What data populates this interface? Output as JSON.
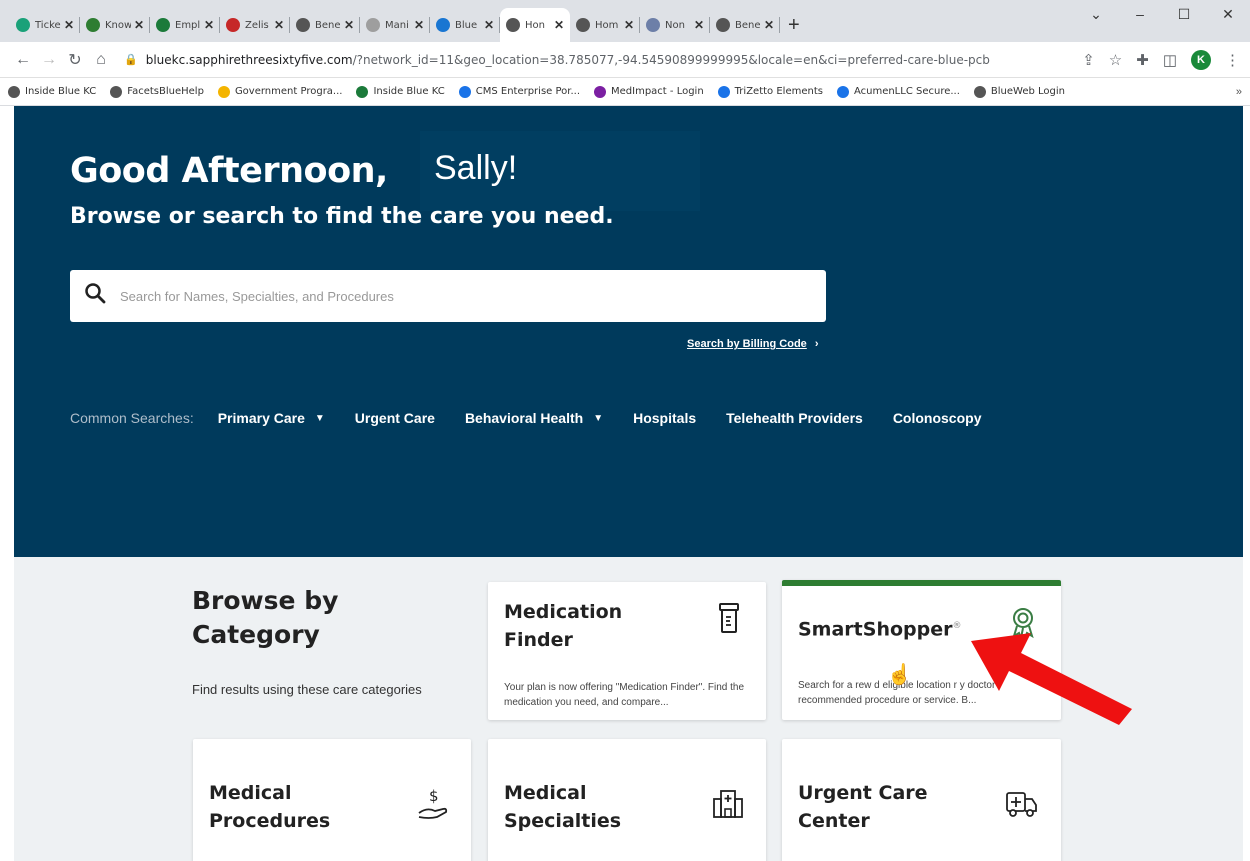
{
  "browser": {
    "tabs": [
      {
        "label": "Ticke",
        "color": "#1aa179"
      },
      {
        "label": "Know",
        "color": "#2e7d32"
      },
      {
        "label": "Empl",
        "color": "#1b7a3a"
      },
      {
        "label": "Zelis",
        "color": "#c62828"
      },
      {
        "label": "Bene",
        "color": "#555555"
      },
      {
        "label": "Mani",
        "color": "#9e9e9e"
      },
      {
        "label": "Blue",
        "color": "#1976d2"
      },
      {
        "label": "Hon",
        "color": "#555555",
        "active": true
      },
      {
        "label": "Hom",
        "color": "#555555"
      },
      {
        "label": "Non",
        "color": "#6d7fa8"
      },
      {
        "label": "Bene",
        "color": "#555555"
      }
    ],
    "url_host": "bluekc.sapphirethreesixtyfive.com",
    "url_path": "/?network_id=11&geo_location=38.785077,-94.54590899999995&locale=en&ci=preferred-care-blue-pcb",
    "profile_initial": "K",
    "bookmarks": [
      {
        "label": "Inside Blue KC",
        "color": "#555555"
      },
      {
        "label": "FacetsBlueHelp",
        "color": "#555555"
      },
      {
        "label": "Government Progra...",
        "color": "#f4b400"
      },
      {
        "label": "Inside Blue KC",
        "color": "#1b7a3a"
      },
      {
        "label": "CMS Enterprise Por...",
        "color": "#1a73e8"
      },
      {
        "label": "MedImpact - Login",
        "color": "#7b1fa2"
      },
      {
        "label": "TriZetto Elements",
        "color": "#1a73e8"
      },
      {
        "label": "AcumenLLC Secure...",
        "color": "#1a73e8"
      },
      {
        "label": "BlueWeb Login",
        "color": "#555555"
      }
    ],
    "bookmarks_more": "»"
  },
  "hero": {
    "greeting": "Good Afternoon,",
    "name": "Sally!",
    "subtitle": "Browse or search to find the care you need.",
    "search_placeholder": "Search for Names, Specialties, and Procedures",
    "billing_link": "Search by Billing Code",
    "common_label": "Common Searches:",
    "common_items": [
      "Primary Care",
      "Urgent Care",
      "Behavioral Health",
      "Hospitals",
      "Telehealth Providers",
      "Colonoscopy"
    ]
  },
  "browse": {
    "title_line1": "Browse by",
    "title_line2": "Category",
    "subtitle": "Find results using these care categories"
  },
  "cards": {
    "medication": {
      "title_line1": "Medication",
      "title_line2": "Finder",
      "desc": "Your plan is now offering \"Medication Finder\". Find the medication you need, and compare..."
    },
    "smartshopper": {
      "title": "SmartShopper",
      "mark": "®",
      "desc": "Search for a rew   d eligible location   r y doctor recommended procedure or service. B..."
    },
    "procedures": {
      "title_line1": "Medical",
      "title_line2": "Procedures"
    },
    "specialties": {
      "title_line1": "Medical",
      "title_line2": "Specialties"
    },
    "urgent": {
      "title_line1": "Urgent Care",
      "title_line2": "Center"
    }
  }
}
